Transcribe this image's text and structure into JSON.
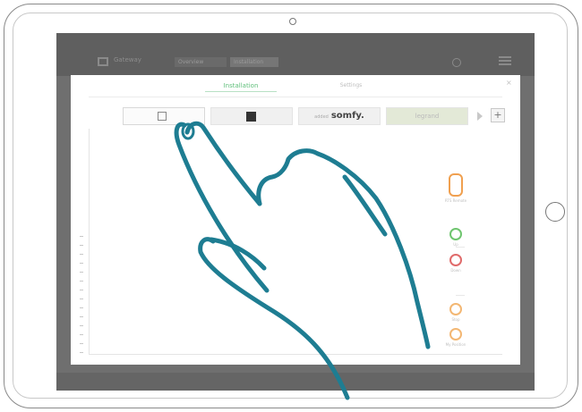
{
  "app": {
    "name": "Gateway",
    "top_tabs": [
      "Overview",
      "Installation"
    ]
  },
  "dialog": {
    "tab_install_label": "Installation",
    "tab_settings_label": "Settings",
    "close_label": "×"
  },
  "brands": {
    "somfy_prefix": "added",
    "somfy_label": "somfy.",
    "legrand_label": "legrand",
    "add_label": "+"
  },
  "devices": [
    {
      "label": "RTS Remote",
      "color": "#f0a050"
    },
    {
      "label": "Up",
      "color": "#6fc56f"
    },
    {
      "label": "Down",
      "color": "#e06b6b"
    },
    {
      "label": "Stop",
      "color": "#f3b773"
    },
    {
      "label": "My Position",
      "color": "#f3b773"
    }
  ],
  "colors": {
    "hand_stroke": "#1e7d92",
    "accent_green": "#5fbf7a"
  },
  "icons": [
    "camera-icon",
    "home-button",
    "menu-icon",
    "app-logo-icon",
    "play-icon",
    "hand-gesture-icon"
  ]
}
